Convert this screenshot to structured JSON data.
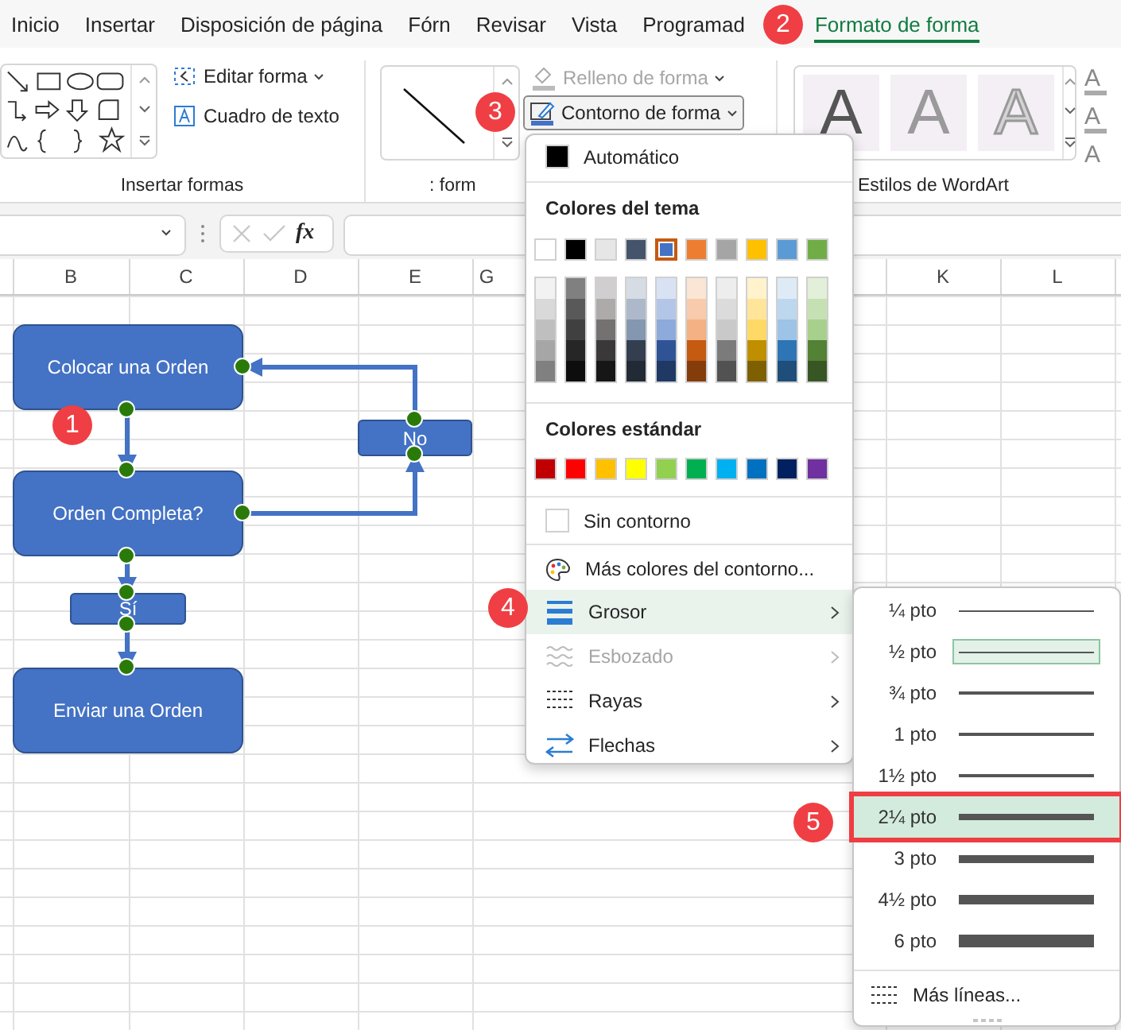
{
  "tabs": [
    {
      "label": "Inicio",
      "selected": false
    },
    {
      "label": "Insertar",
      "selected": false
    },
    {
      "label": "Disposición de página",
      "selected": false
    },
    {
      "label": "Fórn",
      "selected": false
    },
    {
      "label": "Revisar",
      "selected": false
    },
    {
      "label": "Vista",
      "selected": false
    },
    {
      "label": "Programad",
      "selected": false
    },
    {
      "label": "Formato de forma",
      "selected": true
    }
  ],
  "ribbon": {
    "groups": [
      {
        "label": "Insertar formas",
        "commands": [
          {
            "label": "Editar forma",
            "kind": "edit-shape",
            "disabled": false
          },
          {
            "label": "Cuadro de texto",
            "kind": "text-box",
            "disabled": false
          }
        ]
      },
      {
        "label": ": form",
        "commands": [
          {
            "label": "Relleno de forma",
            "kind": "fill",
            "disabled": true
          },
          {
            "label": "Contorno de forma",
            "kind": "outline",
            "disabled": false
          }
        ]
      },
      {
        "label": "Estilos de WordArt",
        "wordart_samples": [
          "A",
          "A",
          "A"
        ],
        "text_tools": [
          "A",
          "A",
          "A"
        ]
      }
    ]
  },
  "formula_bar": {
    "function_label": "fx"
  },
  "columns": [
    "B",
    "C",
    "D",
    "E",
    "G",
    "K",
    "L"
  ],
  "flowchart": {
    "nodes": [
      {
        "label": "Colocar una Orden"
      },
      {
        "label": "No"
      },
      {
        "label": "Orden Completa?"
      },
      {
        "label": "Sí"
      },
      {
        "label": "Enviar una Orden"
      }
    ]
  },
  "outline_menu": {
    "automatic": {
      "label": "Automático",
      "color": "#000000"
    },
    "theme_colors": {
      "title": "Colores del tema",
      "colors": [
        {
          "color": "#ffffff",
          "selected": false
        },
        {
          "color": "#000000",
          "selected": false
        },
        {
          "color": "#e7e6e6",
          "selected": false
        },
        {
          "color": "#44546a",
          "selected": false
        },
        {
          "color": "#4472c4",
          "selected": true
        },
        {
          "color": "#ed7d31",
          "selected": false
        },
        {
          "color": "#a5a5a5",
          "selected": false
        },
        {
          "color": "#ffc000",
          "selected": false
        },
        {
          "color": "#5b9bd5",
          "selected": false
        },
        {
          "color": "#70ad47",
          "selected": false
        }
      ],
      "shade_columns": [
        [
          {
            "color": "#f2f2f2"
          },
          {
            "color": "#d9d9d9"
          },
          {
            "color": "#bfbfbf"
          },
          {
            "color": "#a6a6a6"
          },
          {
            "color": "#808080"
          }
        ],
        [
          {
            "color": "#808080"
          },
          {
            "color": "#595959"
          },
          {
            "color": "#404040"
          },
          {
            "color": "#262626"
          },
          {
            "color": "#0d0d0d"
          }
        ],
        [
          {
            "color": "#d0cece"
          },
          {
            "color": "#aeaaaa"
          },
          {
            "color": "#757171"
          },
          {
            "color": "#3a3838"
          },
          {
            "color": "#171616"
          }
        ],
        [
          {
            "color": "#d6dce4"
          },
          {
            "color": "#adb9ca"
          },
          {
            "color": "#8497b0"
          },
          {
            "color": "#333f4f"
          },
          {
            "color": "#222a35"
          }
        ],
        [
          {
            "color": "#d9e2f3"
          },
          {
            "color": "#b4c6e7"
          },
          {
            "color": "#8eaadb"
          },
          {
            "color": "#2f5496"
          },
          {
            "color": "#1f3864"
          }
        ],
        [
          {
            "color": "#fbe5d5"
          },
          {
            "color": "#f7cbac"
          },
          {
            "color": "#f4b183"
          },
          {
            "color": "#c55a11"
          },
          {
            "color": "#843c0b"
          }
        ],
        [
          {
            "color": "#ededed"
          },
          {
            "color": "#dbdbdb"
          },
          {
            "color": "#c9c9c9"
          },
          {
            "color": "#7b7b7b"
          },
          {
            "color": "#525252"
          }
        ],
        [
          {
            "color": "#fff2cc"
          },
          {
            "color": "#ffe599"
          },
          {
            "color": "#ffd966"
          },
          {
            "color": "#bf8f00"
          },
          {
            "color": "#7f6000"
          }
        ],
        [
          {
            "color": "#deebf6"
          },
          {
            "color": "#bdd7ee"
          },
          {
            "color": "#9dc3e6"
          },
          {
            "color": "#2e75b5"
          },
          {
            "color": "#1e4e79"
          }
        ],
        [
          {
            "color": "#e2efd9"
          },
          {
            "color": "#c5e0b3"
          },
          {
            "color": "#a8d08d"
          },
          {
            "color": "#538135"
          },
          {
            "color": "#375623"
          }
        ]
      ]
    },
    "standard_colors": {
      "title": "Colores estándar",
      "colors": [
        {
          "color": "#c00000"
        },
        {
          "color": "#ff0000"
        },
        {
          "color": "#ffc000"
        },
        {
          "color": "#ffff00"
        },
        {
          "color": "#92d050"
        },
        {
          "color": "#00b050"
        },
        {
          "color": "#00b0f0"
        },
        {
          "color": "#0070c0"
        },
        {
          "color": "#002060"
        },
        {
          "color": "#7030a0"
        }
      ]
    },
    "no_outline": {
      "label": "Sin contorno"
    },
    "more_colors": {
      "label": "Más colores del contorno..."
    },
    "submenus": [
      {
        "label": "Grosor",
        "kind": "weight",
        "highlighted": true,
        "disabled": false
      },
      {
        "label": "Esbozado",
        "kind": "sketch",
        "highlighted": false,
        "disabled": true
      },
      {
        "label": "Rayas",
        "kind": "dashes",
        "highlighted": false,
        "disabled": false
      },
      {
        "label": "Flechas",
        "kind": "arrows",
        "highlighted": false,
        "disabled": false
      }
    ]
  },
  "weight_menu": {
    "items": [
      {
        "label": "¼ pto",
        "selected": false,
        "highlighted": false
      },
      {
        "label": "½ pto",
        "selected": true,
        "highlighted": false
      },
      {
        "label": "¾ pto",
        "selected": false,
        "highlighted": false
      },
      {
        "label": "1 pto",
        "selected": false,
        "highlighted": false
      },
      {
        "label": "1½ pto",
        "selected": false,
        "highlighted": false
      },
      {
        "label": "2¼ pto",
        "selected": false,
        "highlighted": true
      },
      {
        "label": "3 pto",
        "selected": false,
        "highlighted": false
      },
      {
        "label": "4½ pto",
        "selected": false,
        "highlighted": false
      },
      {
        "label": "6 pto",
        "selected": false,
        "highlighted": false
      }
    ],
    "more_lines": {
      "label": "Más líneas..."
    }
  },
  "callouts": [
    {
      "number": "1"
    },
    {
      "number": "2"
    },
    {
      "number": "3"
    },
    {
      "number": "4"
    },
    {
      "number": "5"
    }
  ]
}
